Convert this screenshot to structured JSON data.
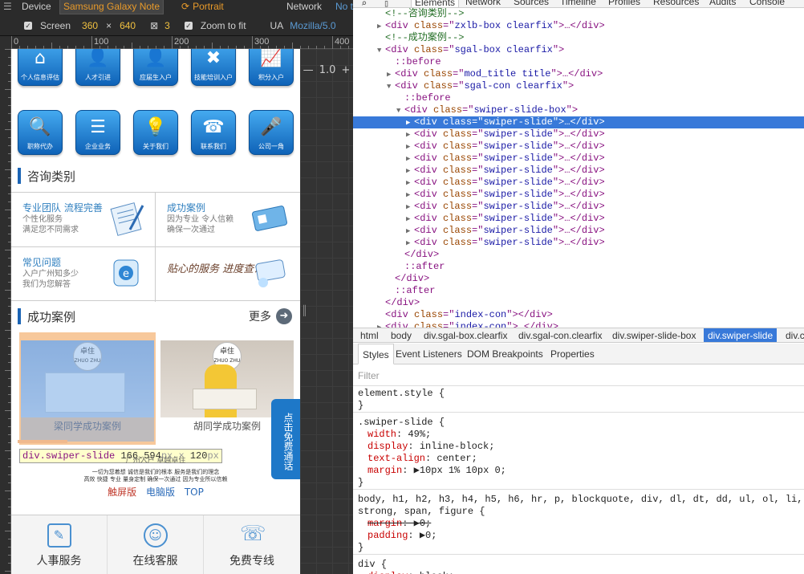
{
  "emulation": {
    "device_label": "Device",
    "device_value": "Samsung Galaxy Note",
    "orientation": "Portrait",
    "network_label": "Network",
    "network_value": "No t",
    "screen_label": "Screen",
    "screen_w": "360",
    "screen_x": "×",
    "screen_h": "640",
    "scale_value": "3",
    "zoom_label": "Zoom to fit",
    "ua_label": "UA",
    "ua_value": "Mozilla/5.0",
    "zoom_level": "1.0",
    "ruler_labels": [
      "0",
      "100",
      "200",
      "300",
      "400"
    ]
  },
  "phone": {
    "icons_row1": [
      {
        "icon": "person-info-icon",
        "glyph": "⌂",
        "label": "个人信息评估"
      },
      {
        "icon": "talent-icon",
        "glyph": "👤",
        "label": "人才引进"
      },
      {
        "icon": "graduate-icon",
        "glyph": "👤",
        "label": "应届生入户"
      },
      {
        "icon": "tools-icon",
        "glyph": "✖",
        "label": "技能培训入户"
      },
      {
        "icon": "chart-icon",
        "glyph": "📈",
        "label": "积分入户"
      }
    ],
    "icons_row2": [
      {
        "icon": "search-icon",
        "glyph": "🔍",
        "label": "职称代办"
      },
      {
        "icon": "document-icon",
        "glyph": "☰",
        "label": "企业业务"
      },
      {
        "icon": "lightbulb-icon",
        "glyph": "💡",
        "label": "关于我们"
      },
      {
        "icon": "phone-icon",
        "glyph": "☎",
        "label": "联系我们"
      },
      {
        "icon": "mic-icon",
        "glyph": "🎤",
        "label": "公司一角"
      }
    ],
    "consult_title": "咨询类别",
    "consult": [
      {
        "title": "专业团队 流程完善",
        "line1": "个性化服务",
        "line2": "满足您不同需求"
      },
      {
        "title": "成功案例",
        "line1": "因为专业 令人信赖",
        "line2": "确保一次通过"
      },
      {
        "title": "常见问题",
        "line1": "入户广州知多少",
        "line2": "我们为您解答"
      },
      {
        "title": "贴心的服务 进度查询",
        "line1": "",
        "line2": ""
      }
    ],
    "cases_title": "成功案例",
    "more_label": "更多",
    "slides": [
      {
        "logo_top": "卓住",
        "logo_bottom": "ZHUO ZHU",
        "caption": "梁同学成功案例"
      },
      {
        "logo_top": "卓住",
        "logo_bottom": "ZHUO ZHU",
        "caption": "胡同学成功案例"
      }
    ],
    "tooltip": {
      "name": "div.swiper-slide",
      "w": "166.594",
      "unit1": "px",
      "x": " × ",
      "h": "120",
      "unit2": "px"
    },
    "float_call": "点击免费通话",
    "slogan_title": "广州入户 卓越卓住",
    "slogan_line1": "一切为您着想  诚信是我们的根本  服务是我们的理念",
    "slogan_line2": "高效   快捷   专业   量身定制   确保一次通过   因为专业所以信赖",
    "links": [
      "触屏版",
      "电脑版",
      "TOP"
    ],
    "bottom_nav": [
      {
        "icon": "edit-icon",
        "glyph": "✎",
        "label": "人事服务"
      },
      {
        "icon": "chat-icon",
        "glyph": "☺",
        "label": "在线客服"
      },
      {
        "icon": "phone-call-icon",
        "glyph": "☏",
        "label": "免费专线"
      }
    ]
  },
  "devtools": {
    "tabs": [
      "Elements",
      "Network",
      "Sources",
      "Timeline",
      "Profiles",
      "Resources",
      "Audits",
      "Console"
    ],
    "active_tab": "Elements",
    "tree": [
      {
        "indent": 3,
        "tri": "",
        "kind": "comment",
        "text": "<!--咨询类别-->"
      },
      {
        "indent": 3,
        "tri": "▶",
        "kind": "el",
        "tag": "div",
        "cls": "zxlb-box clearfix",
        "tail": "…</div>"
      },
      {
        "indent": 3,
        "tri": "",
        "kind": "comment",
        "text": "<!--成功案例-->"
      },
      {
        "indent": 3,
        "tri": "▼",
        "kind": "el",
        "tag": "div",
        "cls": "sgal-box clearfix",
        "tail": ""
      },
      {
        "indent": 4,
        "tri": "",
        "kind": "pseudo",
        "text": "::before"
      },
      {
        "indent": 4,
        "tri": "▶",
        "kind": "el",
        "tag": "div",
        "cls": "mod_title title",
        "tail": "…</div>"
      },
      {
        "indent": 4,
        "tri": "▼",
        "kind": "el",
        "tag": "div",
        "cls": "sgal-con clearfix",
        "tail": ""
      },
      {
        "indent": 5,
        "tri": "",
        "kind": "pseudo",
        "text": "::before"
      },
      {
        "indent": 5,
        "tri": "▼",
        "kind": "el",
        "tag": "div",
        "cls": "swiper-slide-box",
        "tail": ""
      },
      {
        "indent": 6,
        "tri": "▶",
        "kind": "el",
        "tag": "div",
        "cls": "swiper-slide",
        "tail": "…</div>",
        "sel": true
      },
      {
        "indent": 6,
        "tri": "▶",
        "kind": "el",
        "tag": "div",
        "cls": "swiper-slide",
        "tail": "…</div>"
      },
      {
        "indent": 6,
        "tri": "▶",
        "kind": "el",
        "tag": "div",
        "cls": "swiper-slide",
        "tail": "…</div>"
      },
      {
        "indent": 6,
        "tri": "▶",
        "kind": "el",
        "tag": "div",
        "cls": "swiper-slide",
        "tail": "…</div>"
      },
      {
        "indent": 6,
        "tri": "▶",
        "kind": "el",
        "tag": "div",
        "cls": "swiper-slide",
        "tail": "…</div>"
      },
      {
        "indent": 6,
        "tri": "▶",
        "kind": "el",
        "tag": "div",
        "cls": "swiper-slide",
        "tail": "…</div>"
      },
      {
        "indent": 6,
        "tri": "▶",
        "kind": "el",
        "tag": "div",
        "cls": "swiper-slide",
        "tail": "…</div>"
      },
      {
        "indent": 6,
        "tri": "▶",
        "kind": "el",
        "tag": "div",
        "cls": "swiper-slide",
        "tail": "…</div>"
      },
      {
        "indent": 6,
        "tri": "▶",
        "kind": "el",
        "tag": "div",
        "cls": "swiper-slide",
        "tail": "…</div>"
      },
      {
        "indent": 6,
        "tri": "▶",
        "kind": "el",
        "tag": "div",
        "cls": "swiper-slide",
        "tail": "…</div>"
      },
      {
        "indent": 6,
        "tri": "▶",
        "kind": "el",
        "tag": "div",
        "cls": "swiper-slide",
        "tail": "…</div>"
      },
      {
        "indent": 5,
        "tri": "",
        "kind": "close",
        "text": "</div>"
      },
      {
        "indent": 5,
        "tri": "",
        "kind": "pseudo",
        "text": "::after"
      },
      {
        "indent": 4,
        "tri": "",
        "kind": "close",
        "text": "</div>"
      },
      {
        "indent": 4,
        "tri": "",
        "kind": "pseudo",
        "text": "::after"
      },
      {
        "indent": 3,
        "tri": "",
        "kind": "close",
        "text": "</div>"
      },
      {
        "indent": 3,
        "tri": "",
        "kind": "el",
        "tag": "div",
        "cls": "index-con",
        "tail": "</div>"
      },
      {
        "indent": 3,
        "tri": "▶",
        "kind": "el",
        "tag": "div",
        "cls": "index-con",
        "tail": "…</div>"
      }
    ],
    "breadcrumbs": [
      "html",
      "body",
      "div.sgal-box.clearfix",
      "div.sgal-con.clearfix",
      "div.swiper-slide-box",
      "div.swiper-slide",
      "div.co"
    ],
    "active_crumb": "div.swiper-slide",
    "sub_tabs": [
      "Styles",
      "Event Listeners",
      "DOM Breakpoints",
      "Properties"
    ],
    "filter_placeholder": "Filter",
    "styles": [
      {
        "selector": "element.style {",
        "props": [],
        "close": "}"
      },
      {
        "selector": ".swiper-slide {",
        "props": [
          {
            "n": "width",
            "v": "49%;"
          },
          {
            "n": "display",
            "v": "inline-block;"
          },
          {
            "n": "text-align",
            "v": "center;"
          },
          {
            "n": "margin",
            "v": "▶10px 1% 10px 0;"
          }
        ],
        "close": "}"
      },
      {
        "selector": "body, h1, h2, h3, h4, h5, h6, hr, p, blockquote, div, dl, dt, dd, ul, ol, li, p, pre, form,",
        "selector2": "strong, span, figure {",
        "props": [
          {
            "n": "margin",
            "v": "▶0;",
            "strike": true
          },
          {
            "n": "padding",
            "v": "▶0;"
          }
        ],
        "close": "}"
      },
      {
        "selector": "div {",
        "props": [
          {
            "n": "display",
            "v": "block;"
          }
        ],
        "close": ""
      }
    ]
  }
}
